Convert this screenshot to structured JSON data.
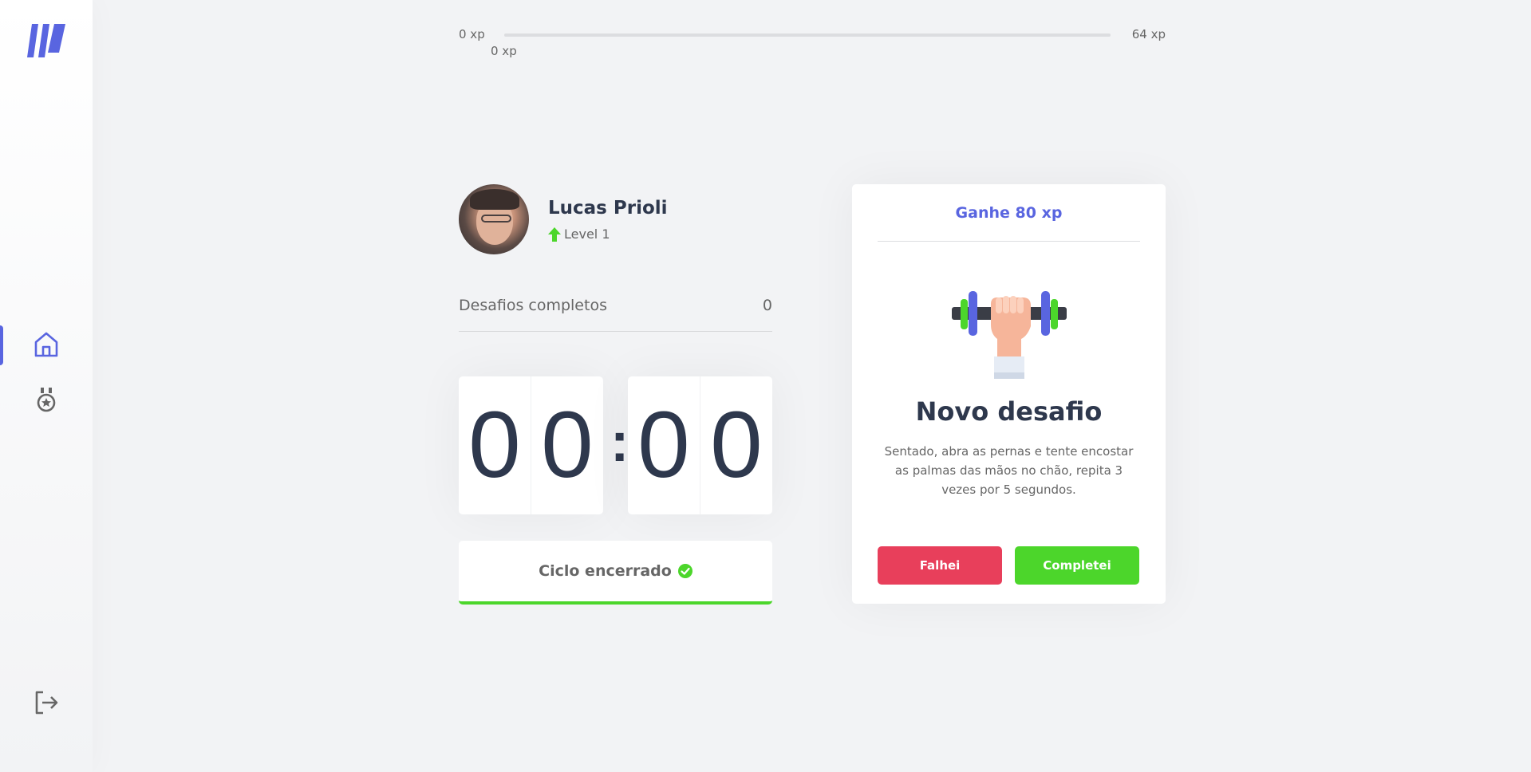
{
  "colors": {
    "accent": "#5965e0",
    "success": "#4cd62b",
    "danger": "#e83f5b",
    "title": "#2e384d",
    "text": "#666666",
    "background": "#f2f3f5"
  },
  "sidebar": {
    "items": [
      {
        "icon": "home-icon",
        "active": true
      },
      {
        "icon": "award-icon",
        "active": false
      }
    ],
    "logout_icon": "logout-icon"
  },
  "xp": {
    "min_label": "0 xp",
    "max_label": "64 xp",
    "current_label": "0 xp",
    "progress_percent": 0
  },
  "profile": {
    "name": "Lucas Prioli",
    "level_label": "Level 1"
  },
  "completed_challenges": {
    "label": "Desafios completos",
    "count": "0"
  },
  "countdown": {
    "minute_left": "0",
    "minute_right": "0",
    "separator": ":",
    "second_left": "0",
    "second_right": "0"
  },
  "cycle_button": {
    "label": "Ciclo encerrado"
  },
  "challenge": {
    "header": "Ganhe 80 xp",
    "title": "Novo desafio",
    "description": "Sentado, abra as pernas e tente encostar as palmas das mãos no chão, repita 3 vezes por 5 segundos.",
    "fail_label": "Falhei",
    "success_label": "Completei"
  }
}
